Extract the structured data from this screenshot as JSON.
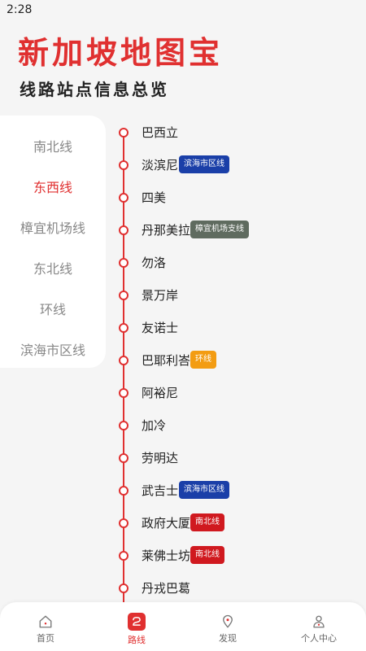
{
  "status_bar": {
    "time": "2:28"
  },
  "header": {
    "title": "新加坡地图宝",
    "subtitle": "线路站点信息总览"
  },
  "line_menu": {
    "items": [
      {
        "label": "南北线",
        "active": false
      },
      {
        "label": "东西线",
        "active": true
      },
      {
        "label": "樟宜机场线",
        "active": false
      },
      {
        "label": "东北线",
        "active": false
      },
      {
        "label": "环线",
        "active": false
      },
      {
        "label": "滨海市区线",
        "active": false
      }
    ]
  },
  "route": {
    "color": "#e03030",
    "stations": [
      {
        "name": "巴西立"
      },
      {
        "name": "淡滨尼",
        "transfer": "滨海市区线",
        "transfer_color": "#1a3fa8"
      },
      {
        "name": "四美"
      },
      {
        "name": "丹那美拉",
        "transfer": "樟宜机场支线",
        "transfer_color": "#5f6b5f"
      },
      {
        "name": "勿洛"
      },
      {
        "name": "景万岸"
      },
      {
        "name": "友诺士"
      },
      {
        "name": "巴耶利峇",
        "transfer": "环线",
        "transfer_color": "#f39c12"
      },
      {
        "name": "阿裕尼"
      },
      {
        "name": "加冷"
      },
      {
        "name": "劳明达"
      },
      {
        "name": "武吉士",
        "transfer": "滨海市区线",
        "transfer_color": "#1a3fa8"
      },
      {
        "name": "政府大厦",
        "transfer": "南北线",
        "transfer_color": "#d0191f"
      },
      {
        "name": "莱佛士坊",
        "transfer": "南北线",
        "transfer_color": "#d0191f"
      },
      {
        "name": "丹戎巴葛"
      }
    ]
  },
  "bottom_nav": {
    "items": [
      {
        "label": "首页",
        "icon": "home-icon",
        "active": false
      },
      {
        "label": "路线",
        "icon": "route-icon",
        "active": true
      },
      {
        "label": "发现",
        "icon": "location-pin-icon",
        "active": false
      },
      {
        "label": "个人中心",
        "icon": "user-icon",
        "active": false
      }
    ]
  },
  "colors": {
    "accent": "#e03030",
    "background": "#f5f5f5",
    "inactive_text": "#888888"
  }
}
